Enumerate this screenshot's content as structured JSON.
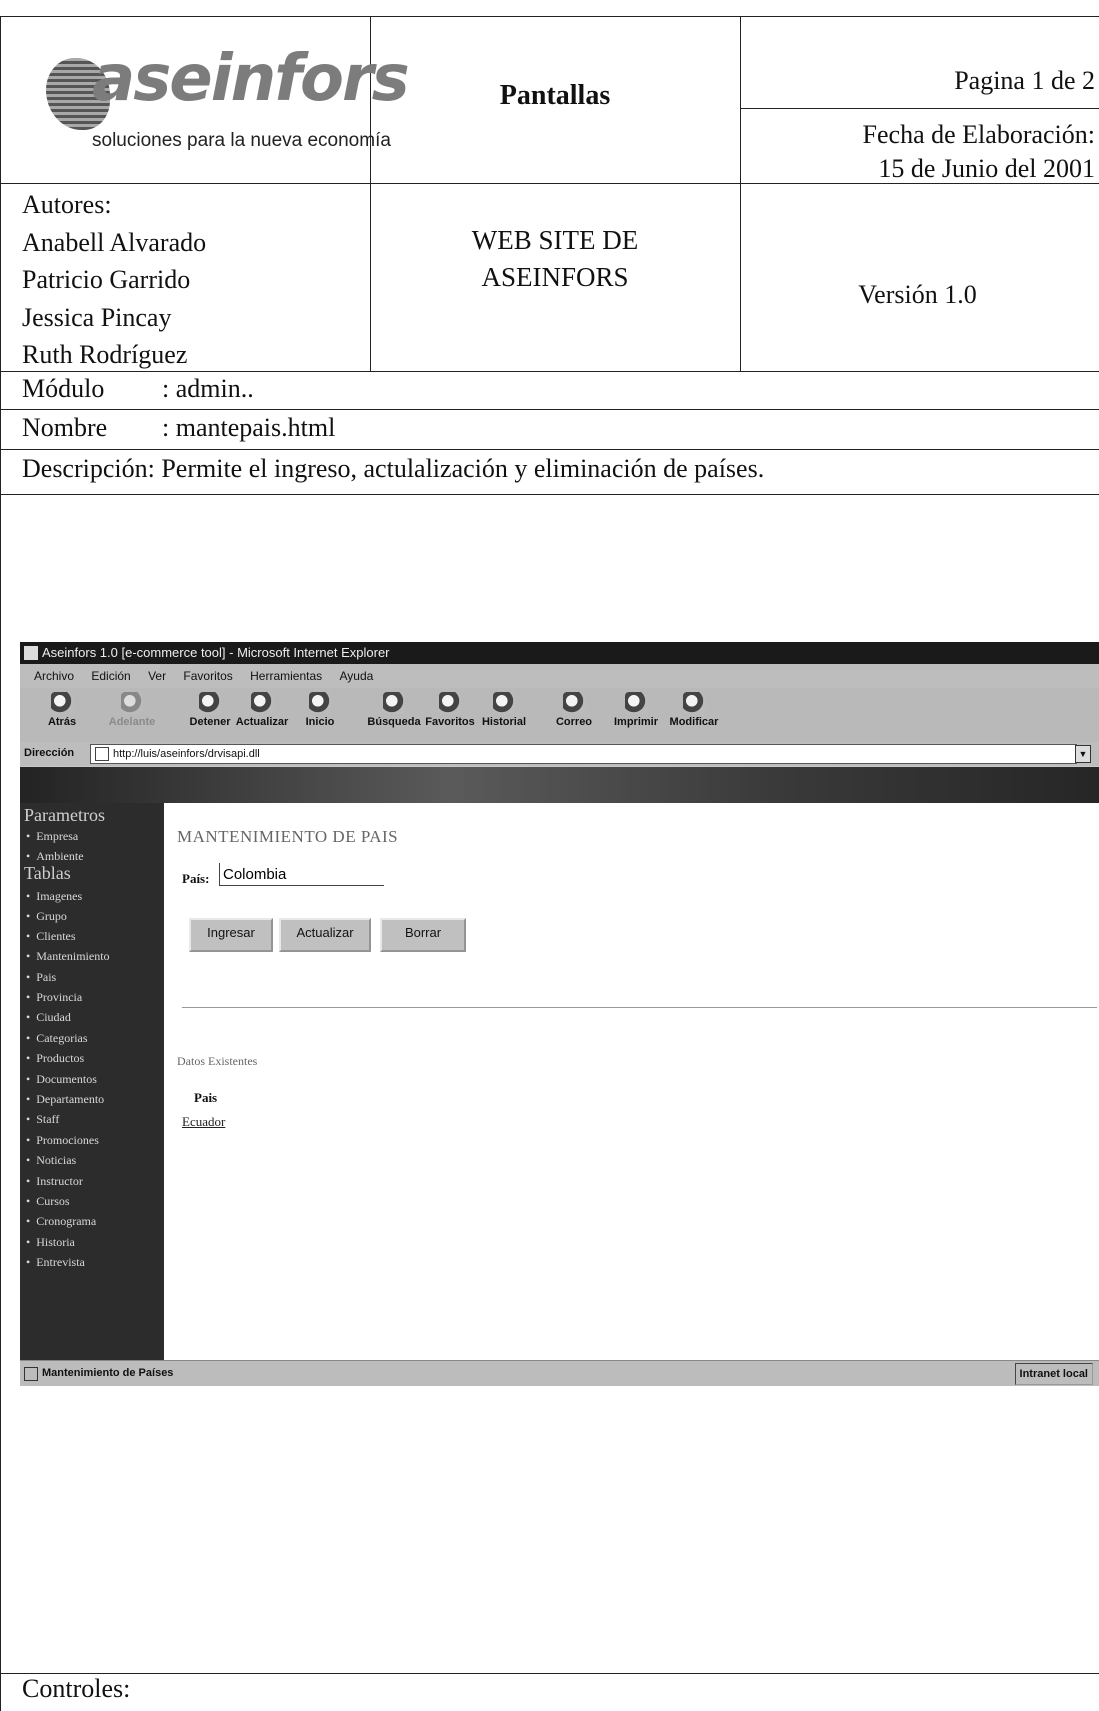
{
  "header": {
    "logo_word": "aseinfors",
    "logo_tagline": "soluciones para la nueva economía",
    "title": "Pantallas",
    "page": "Pagina 1 de 2",
    "date_label": "Fecha de Elaboración:",
    "date_value": "15 de Junio del 2001"
  },
  "authors": {
    "label": "Autores:",
    "names": [
      "Anabell Alvarado",
      "Patricio Garrido",
      "Jessica Pincay",
      "Ruth Rodríguez"
    ]
  },
  "project": {
    "line1": "WEB SITE DE",
    "line2": "ASEINFORS"
  },
  "version": "Versión 1.0",
  "modulo": {
    "label": "Módulo",
    "value": ": admin.."
  },
  "nombre": {
    "label": "Nombre",
    "value": ": mantepais.html"
  },
  "descripcion": "Descripción: Permite el ingreso, actulalización y eliminación de países.",
  "controles": "Controles:",
  "screenshot": {
    "window_title": "Aseinfors 1.0 [e-commerce tool] - Microsoft Internet Explorer",
    "menu": [
      "Archivo",
      "Edición",
      "Ver",
      "Favoritos",
      "Herramientas",
      "Ayuda"
    ],
    "toolbar": [
      "Atrás",
      "Adelante",
      "Detener",
      "Actualizar",
      "Inicio",
      "Búsqueda",
      "Favoritos",
      "Historial",
      "Correo",
      "Imprimir",
      "Modificar"
    ],
    "address_label": "Dirección",
    "address": "http://luis/aseinfors/drvisapi.dll",
    "sidebar": {
      "section1": "Parametros",
      "items1": [
        "Empresa",
        "Ambiente"
      ],
      "section2": "Tablas",
      "items2": [
        "Imagenes",
        "Grupo",
        "Clientes",
        "Mantenimiento",
        "Pais",
        "Provincia",
        "Ciudad",
        "Categorias",
        "Productos",
        "Documentos",
        "Departamento",
        "Staff",
        "Promociones",
        "Noticias",
        "Instructor",
        "Cursos",
        "Cronograma",
        "Historia",
        "Entrevista"
      ]
    },
    "content": {
      "title": "MANTENIMIENTO DE PAIS",
      "field_label": "País:",
      "field_value": "Colombia",
      "buttons": [
        "Ingresar",
        "Actualizar",
        "Borrar"
      ],
      "section": "Datos Existentes",
      "column_header": "Pais",
      "rows": [
        "Ecuador"
      ]
    },
    "status_text": "Mantenimiento de Países",
    "status_zone": "Intranet local"
  }
}
